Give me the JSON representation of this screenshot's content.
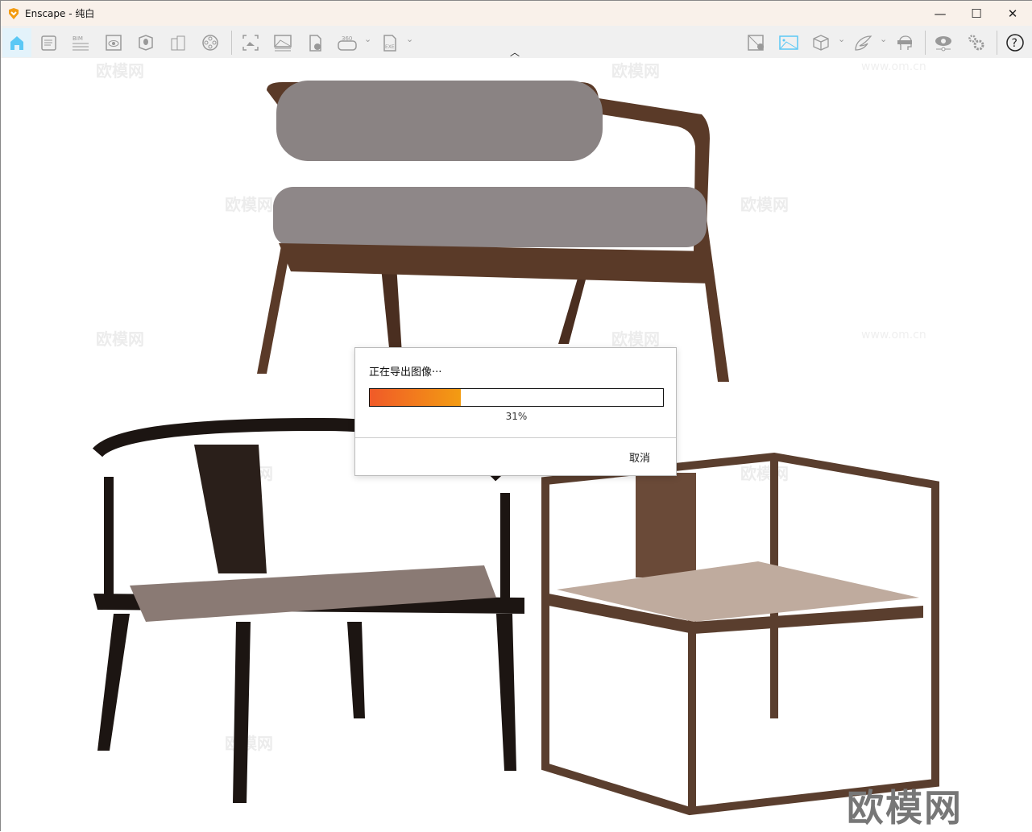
{
  "window": {
    "title": "Enscape - 纯白",
    "minimize_icon": "minimize-icon",
    "maximize_icon": "maximize-icon",
    "close_icon": "close-icon"
  },
  "toolbar": {
    "left_icons": [
      "home-icon",
      "notes-icon",
      "bim-icon",
      "view-icon",
      "site-icon",
      "building-icon",
      "video-icon",
      "screenshot-icon",
      "render-image-icon",
      "panorama-upload-icon",
      "panorama-360-icon",
      "exe-export-icon"
    ],
    "bim_label": "BIM",
    "pano_label": "360",
    "exe_label": "EXE",
    "right_icons": [
      "map-location-icon",
      "image-active-icon",
      "asset-cube-icon",
      "wing-icon",
      "vr-headset-icon",
      "visual-settings-icon",
      "settings-gears-icon",
      "help-icon"
    ],
    "help_label": "?",
    "active_color": "#5bc8f5"
  },
  "dialog": {
    "title": "正在导出图像···",
    "progress_percent": 31,
    "progress_label": "31%",
    "cancel_label": "取消",
    "progress_colors": [
      "#f05a28",
      "#f39c12"
    ]
  },
  "watermark": {
    "text": "欧模网",
    "url_text": "www.om.cn"
  }
}
